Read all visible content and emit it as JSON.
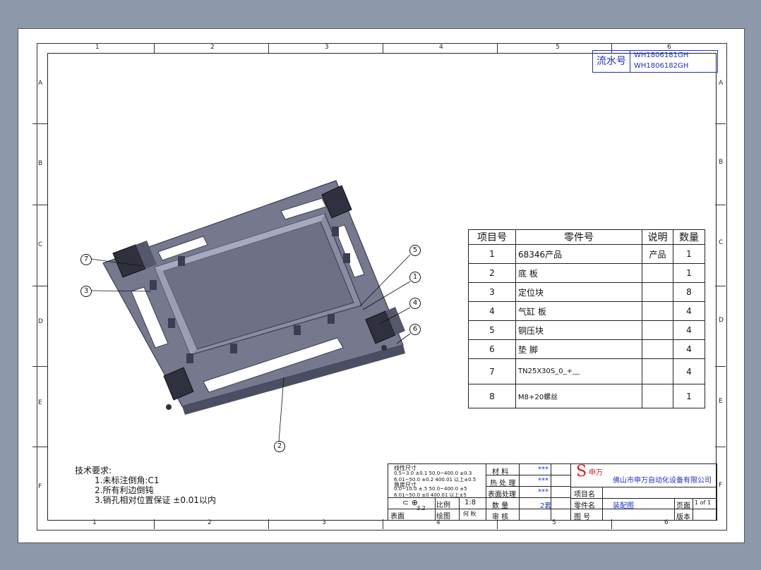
{
  "serial": {
    "label": "流水号",
    "values": [
      "WH1806181GH",
      "WH1806182GH"
    ]
  },
  "zones": {
    "cols": [
      "1",
      "2",
      "3",
      "4",
      "5",
      "6"
    ],
    "rows": [
      "A",
      "B",
      "C",
      "D",
      "E",
      "F"
    ]
  },
  "bom": {
    "headers": [
      "项目号",
      "零件号",
      "说明",
      "数量"
    ],
    "rows": [
      {
        "no": "1",
        "part": "68346产品",
        "desc": "产品",
        "qty": "1"
      },
      {
        "no": "2",
        "part": "底 板",
        "desc": "",
        "qty": "1"
      },
      {
        "no": "3",
        "part": "定位块",
        "desc": "",
        "qty": "8"
      },
      {
        "no": "4",
        "part": "气缸 板",
        "desc": "",
        "qty": "4"
      },
      {
        "no": "5",
        "part": "铜压块",
        "desc": "",
        "qty": "4"
      },
      {
        "no": "6",
        "part": "垫 脚",
        "desc": "",
        "qty": "4"
      },
      {
        "no": "7",
        "part": "TN25X30S_0_+__",
        "desc": "",
        "qty": "4"
      },
      {
        "no": "8",
        "part": "M8+20螺丝",
        "desc": "",
        "qty": "1"
      }
    ]
  },
  "callouts": [
    "7",
    "3",
    "5",
    "1",
    "4",
    "6",
    "2"
  ],
  "tech": {
    "title": "技术要求:",
    "lines": [
      "1.未标注倒角:C1",
      "2.所有利边倒钝",
      "3.销孔相对位置保证 ±0.01以内"
    ]
  },
  "title_block": {
    "tol1_title": "线性尺寸",
    "tol1_a": "0.5~3.0 ±0.1   50.0~400.0 ±0.3",
    "tol1_b": "6.01~50.0 ±0.2   400.01 以上±0.5",
    "tol2_title": "角度尺寸",
    "tol2_a": "0.0~10.0 ±.5   50.0~400.0 ±5",
    "tol2_b": "6.01~50.0 ±0   400.01 以上±5",
    "surface": "表面",
    "roughness": "3.2",
    "scale_label": "比例",
    "scale_value": "1:8",
    "drawn_label": "绘图",
    "drawn_value": "何 秋",
    "material_label": "材 料",
    "material_value": "***",
    "heat_label": "热 处 理",
    "heat_value": "***",
    "surface_label": "表面处理",
    "surface_value": "***",
    "qty_label": "数 量",
    "qty_value": "2套",
    "check_label": "审 核",
    "company_logo": "S",
    "company_short": "申万",
    "company_name": "佛山市申万自动化设备有限公司",
    "project_label": "项目名",
    "partname_label": "零件名",
    "partname_value": "装配图",
    "drawing_label": "图 号",
    "page_label": "页面",
    "page_value": "1 of 1",
    "version_label": "版本"
  }
}
